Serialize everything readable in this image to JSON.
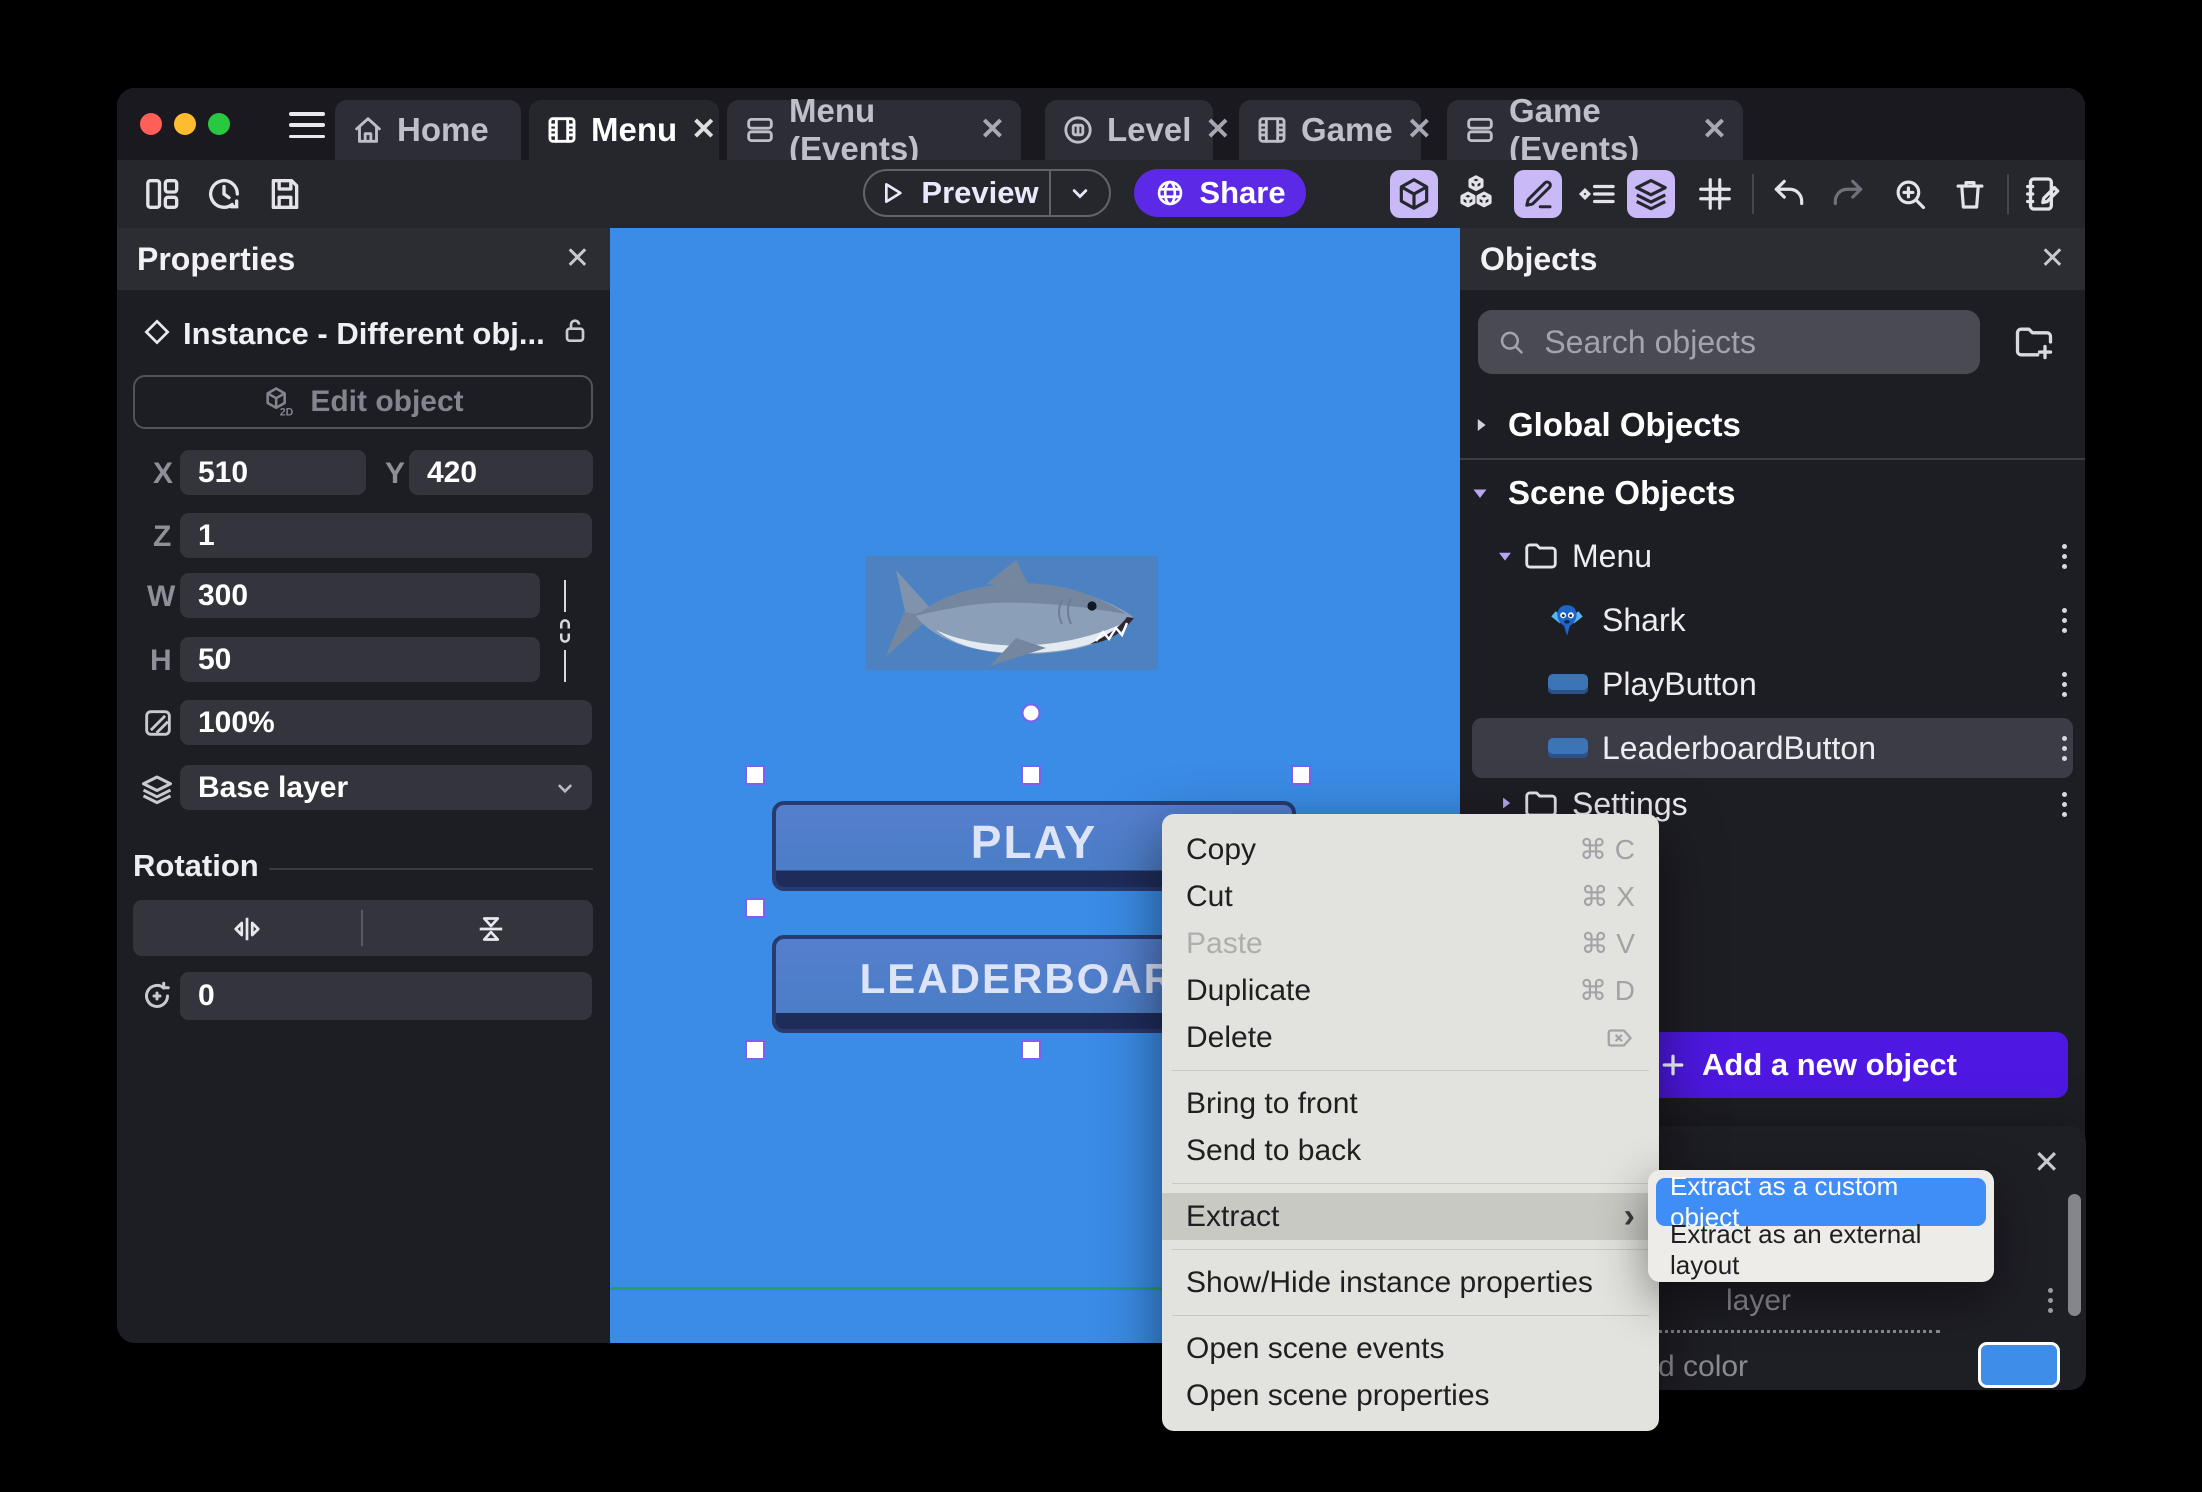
{
  "ui": {
    "close": "✕",
    "submenu_arrow": "›"
  },
  "window": {
    "tabs": [
      {
        "label": "Home"
      },
      {
        "label": "Menu"
      },
      {
        "label": "Menu (Events)"
      },
      {
        "label": "Level"
      },
      {
        "label": "Game"
      },
      {
        "label": "Game (Events)"
      }
    ]
  },
  "toolbar": {
    "preview_label": "Preview",
    "share_label": "Share"
  },
  "properties": {
    "title": "Properties",
    "instance_label": "Instance  -  Different obj...",
    "edit_object_label": "Edit object",
    "fields": {
      "x_label": "X",
      "x": "510",
      "y_label": "Y",
      "y": "420",
      "z_label": "Z",
      "z": "1",
      "w_label": "W",
      "w": "300",
      "h_label": "H",
      "h": "50",
      "opacity": "100%",
      "layer": "Base layer",
      "rotation_label": "Rotation",
      "rotation": "0"
    }
  },
  "canvas": {
    "play": "PLAY",
    "leaderboard": "LEADERBOARD"
  },
  "objects": {
    "title": "Objects",
    "search_placeholder": "Search objects",
    "global_section": "Global Objects",
    "scene_section": "Scene Objects",
    "tree": [
      {
        "label": "Menu"
      },
      {
        "label": "Shark"
      },
      {
        "label": "PlayButton"
      },
      {
        "label": "LeaderboardButton"
      },
      {
        "label": "Settings"
      }
    ],
    "add_button": "Add a new object"
  },
  "context_menu": {
    "items": [
      {
        "label": "Copy",
        "shortcut": "⌘ C"
      },
      {
        "label": "Cut",
        "shortcut": "⌘ X"
      },
      {
        "label": "Paste",
        "shortcut": "⌘ V"
      },
      {
        "label": "Duplicate",
        "shortcut": "⌘ D"
      },
      {
        "label": "Delete",
        "shortcut": ""
      },
      {
        "label": "Bring to front"
      },
      {
        "label": "Send to back"
      },
      {
        "label": "Extract"
      },
      {
        "label": "Show/Hide instance properties"
      },
      {
        "label": "Open scene events"
      },
      {
        "label": "Open scene properties"
      }
    ],
    "submenu": [
      {
        "label": "Extract as a custom object"
      },
      {
        "label": "Extract as an external layout"
      }
    ]
  },
  "layers_popover": {
    "layer_fragment": "layer",
    "color_fragment": "d color"
  },
  "colors": {
    "canvas_blue": "#3a8ce6",
    "accent_purple": "#5c2ae6",
    "add_button_purple": "#4e18e2",
    "selection_purple": "#7e5ff2",
    "submenu_highlight": "#3f8df6",
    "swatch_blue": "#3e8ee9"
  }
}
